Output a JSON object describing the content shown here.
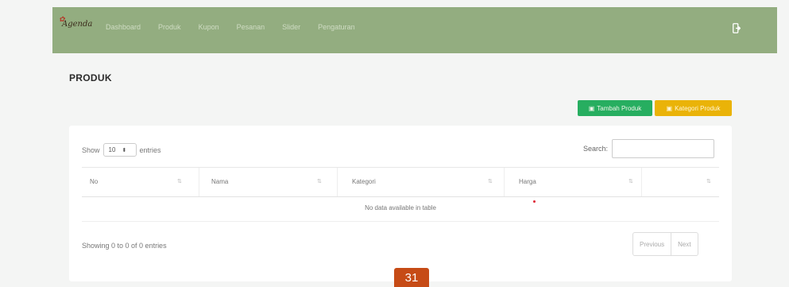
{
  "navbar": {
    "brand": "Agenda",
    "items": [
      "Dashboard",
      "Produk",
      "Kupon",
      "Pesanan",
      "Slider",
      "Pengaturan"
    ],
    "logout_icon": "logout-icon"
  },
  "page": {
    "title": "PRODUK"
  },
  "actions": {
    "add_label": "Tambah Produk",
    "category_label": "Kategori Produk"
  },
  "table": {
    "length": {
      "show": "Show",
      "value": "10",
      "entries": "entries"
    },
    "search_label": "Search:",
    "columns": [
      "No",
      "Nama",
      "Kategori",
      "Harga",
      ""
    ],
    "empty": "No data available in table",
    "info": "Showing 0 to 0 of 0 entries",
    "previous": "Previous",
    "next": "Next"
  },
  "page_number": "31",
  "colors": {
    "navbar": "#93ad80",
    "add": "#27ae60",
    "category": "#eab308",
    "page_badge": "#c64b16"
  }
}
